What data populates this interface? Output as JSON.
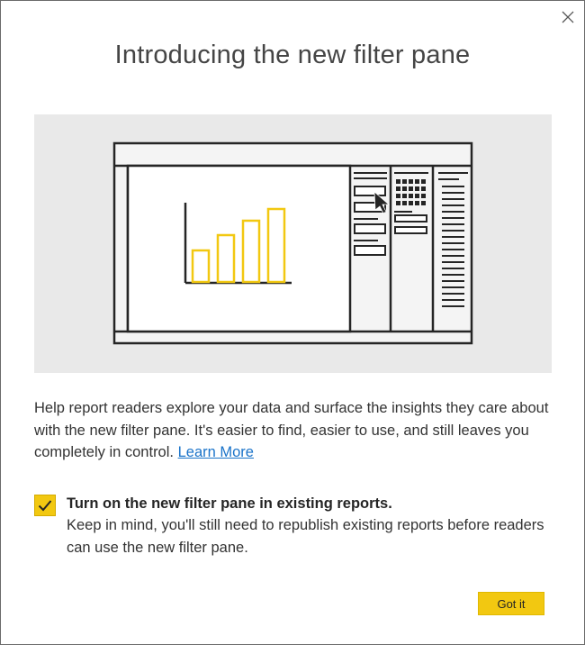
{
  "dialog": {
    "title": "Introducing the new filter pane",
    "close_icon": "close-icon",
    "description": "Help report readers explore your data and surface the insights they care about with the new filter pane. It's easier to find, easier to use, and still leaves you completely in control.",
    "learn_more": "Learn More",
    "checkbox": {
      "checked": true,
      "label": "Turn on the new filter pane in existing reports.",
      "sublabel": "Keep in mind, you'll still need to republish existing reports before readers can use the new filter pane."
    },
    "primary_button": "Got it"
  },
  "colors": {
    "accent": "#f2c811",
    "link": "#1a73c9",
    "illustration_bg": "#e9e9e9",
    "text": "#333333"
  }
}
